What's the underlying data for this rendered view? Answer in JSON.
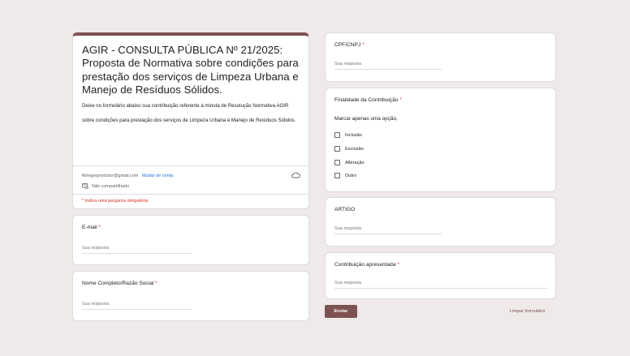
{
  "header": {
    "title": "AGIR -  CONSULTA PÚBLICA Nº 21/2025:  Proposta de Normativa sobre condições para prestação dos serviços de Limpeza Urbana e Manejo de Resíduos Sólidos.",
    "description_1": "Deixe no formulário abaixo sua contribuição referente à minuta de Resolução Normativa AGIR",
    "description_2": "sobre condições para prestação dos serviços de Limpeza Urbana e Manejo de Resíduos Sólidos.",
    "account_email": "fkriegerprodutor@gmail.com",
    "switch_account": "Mudar de conta",
    "not_shared": "Não compartilhado",
    "required_note": "* Indica uma pergunta obrigatória",
    "accent_color": "#7d5252"
  },
  "questions": {
    "email": {
      "label": "E-mail",
      "required_mark": "*",
      "placeholder": "Sua resposta"
    },
    "name": {
      "label": "Nome Completo/Razão Social",
      "required_mark": "*",
      "placeholder": "Sua resposta"
    },
    "cpf": {
      "label": "CPF/CNPJ",
      "required_mark": "*",
      "placeholder": "Sua resposta"
    },
    "finalidade": {
      "label": "Finalidade da Contribuição",
      "required_mark": "*",
      "hint": "Marcar apenas uma opção,",
      "options": [
        "Inclusão",
        "Exclusão",
        "Alteração",
        "Outro"
      ]
    },
    "artigo": {
      "label": "ARTIGO",
      "placeholder": "Sua resposta"
    },
    "contribuicao": {
      "label": "Contribuição apresentada",
      "required_mark": "*",
      "placeholder": "Sua resposta"
    }
  },
  "actions": {
    "submit": "Enviar",
    "clear": "Limpar formulário"
  }
}
